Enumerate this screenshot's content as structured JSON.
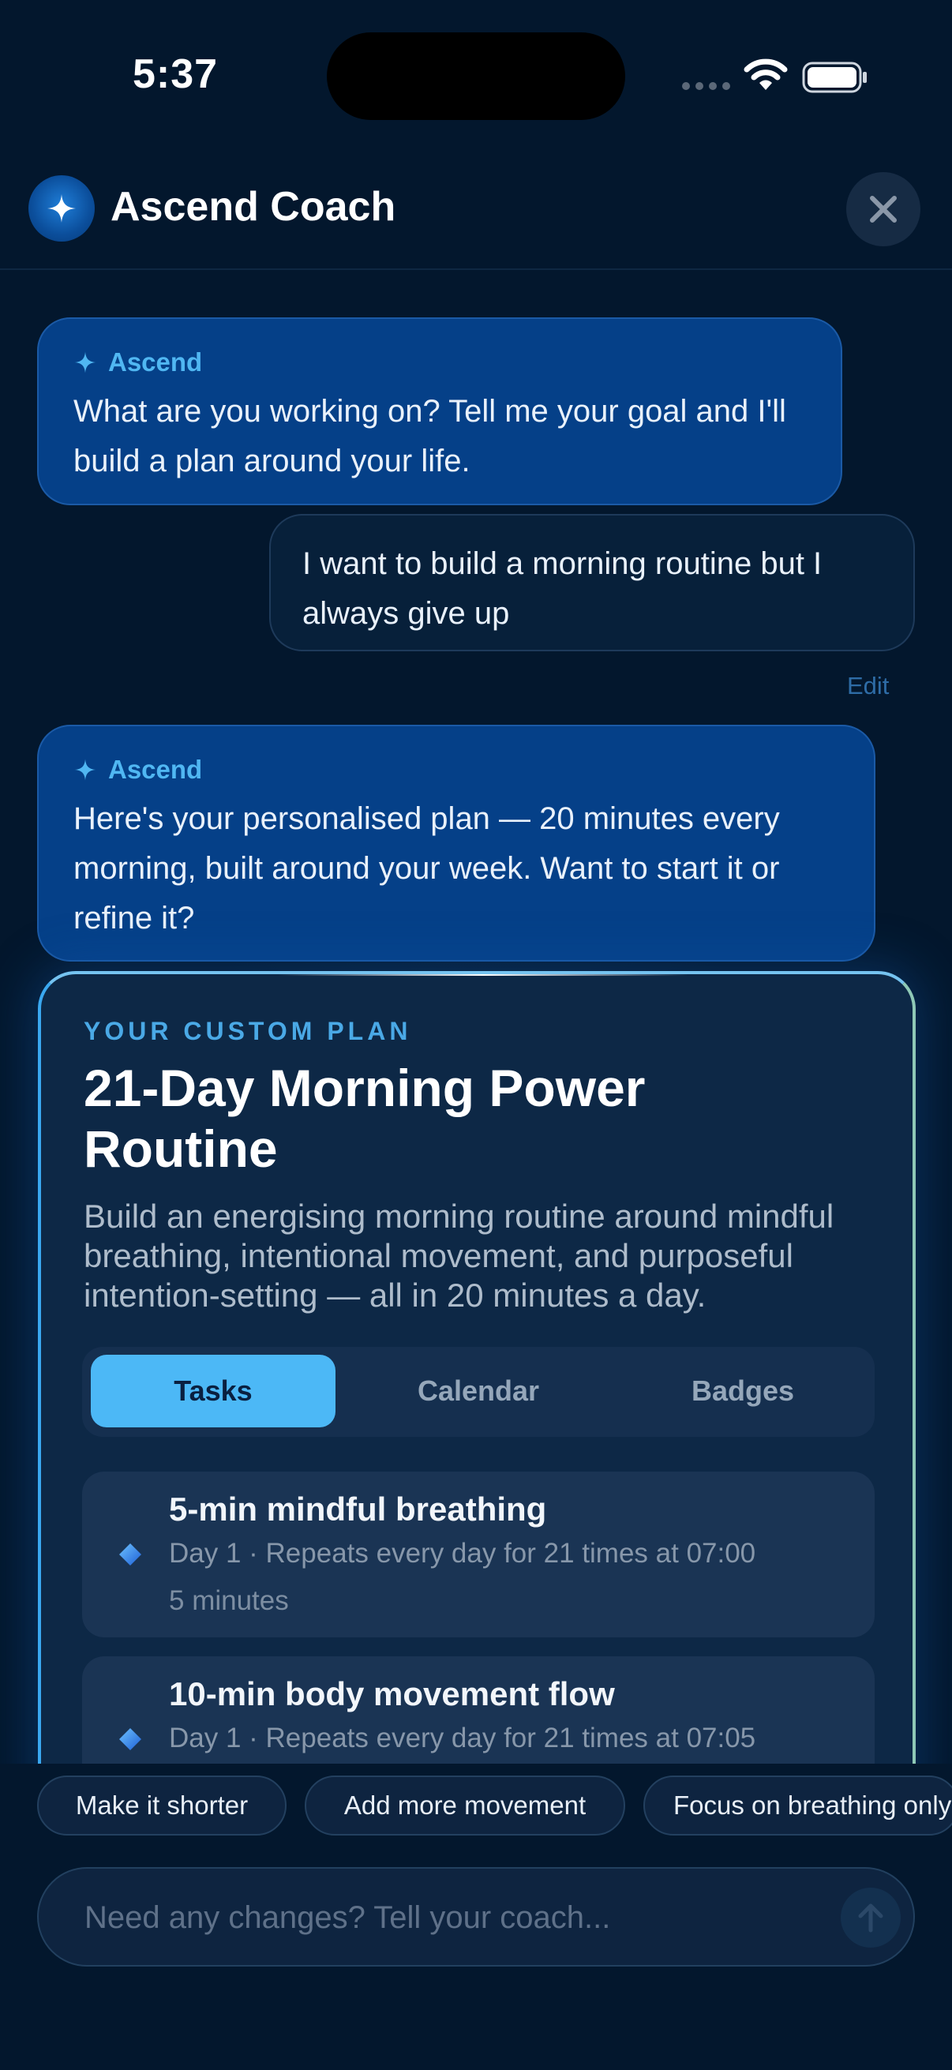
{
  "status_bar": {
    "time": "5:37"
  },
  "header": {
    "title": "Ascend Coach"
  },
  "messages": [
    {
      "sender": "Ascend",
      "text": "What are you working on? Tell me your goal and I'll build a plan around your life."
    },
    {
      "sender": "user",
      "text": "I want to build a morning routine but I always give up",
      "edit_label": "Edit"
    },
    {
      "sender": "Ascend",
      "text": "Here's your personalised plan — 20 minutes every morning, built around your week. Want to start it or refine it?"
    }
  ],
  "plan": {
    "eyebrow": "YOUR CUSTOM PLAN",
    "title": "21-Day Morning Power Routine",
    "description": "Build an energising morning routine around mindful breathing, intentional movement, and purposeful intention-setting — all in 20 minutes a day.",
    "tabs": [
      "Tasks",
      "Calendar",
      "Badges"
    ],
    "active_tab": "Tasks",
    "tasks": [
      {
        "title": "5-min mindful breathing",
        "schedule": "Day 1 · Repeats every day for 21 times at 07:00",
        "duration": "5 minutes"
      },
      {
        "title": "10-min body movement flow",
        "schedule": "Day 1 · Repeats every day for 21 times at 07:05"
      }
    ]
  },
  "suggestions": [
    "Make it shorter",
    "Add more movement",
    "Focus on breathing only"
  ],
  "composer": {
    "placeholder": "Need any changes? Tell your coach..."
  },
  "colors": {
    "background": "#03172d",
    "ai_bubble": "#054088",
    "accent": "#4cb8f6",
    "card": "#0d2846"
  }
}
